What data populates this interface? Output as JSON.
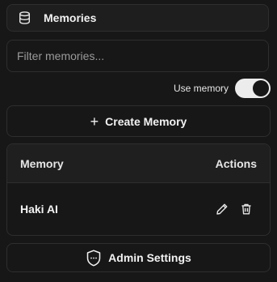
{
  "header": {
    "title": "Memories",
    "icon": "database-icon"
  },
  "filter": {
    "placeholder": "Filter memories...",
    "value": ""
  },
  "use_memory": {
    "label": "Use memory",
    "enabled": true
  },
  "create_button": {
    "label": "Create Memory",
    "icon": "plus-icon"
  },
  "table": {
    "columns": {
      "memory": "Memory",
      "actions": "Actions"
    },
    "rows": [
      {
        "name": "Haki AI",
        "actions": [
          "edit-icon",
          "trash-icon"
        ]
      }
    ]
  },
  "admin_button": {
    "label": "Admin Settings",
    "icon": "shield-icon"
  },
  "colors": {
    "background": "#171717",
    "border": "#2e2e2e",
    "text": "#ececec",
    "toggle_on": "#ececec"
  }
}
